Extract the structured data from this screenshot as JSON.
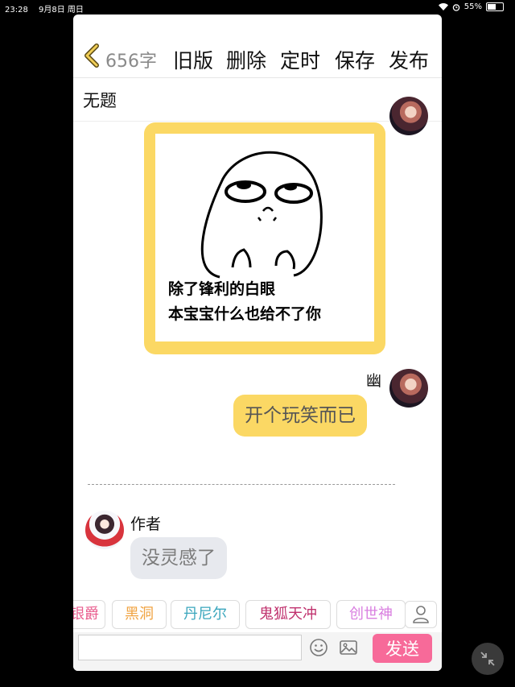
{
  "status_bar": {
    "time": "23:28",
    "date": "9月8日 周日",
    "battery": "55%",
    "battery_level": 0.55
  },
  "header": {
    "char_count": "656字",
    "actions": [
      "旧版",
      "删除",
      "定时",
      "保存",
      "发布"
    ]
  },
  "title": "无题",
  "chat": {
    "meme": {
      "line1": "除了锋利的白眼",
      "line2": "本宝宝什么也给不了你"
    },
    "message1": {
      "sender": "幽",
      "text": "开个玩笑而已"
    },
    "message2": {
      "sender": "作者",
      "text": "没灵感了"
    }
  },
  "tags": [
    {
      "label": "银爵",
      "color": "#e95d8e"
    },
    {
      "label": "黑洞",
      "color": "#f0a341"
    },
    {
      "label": "丹尼尔",
      "color": "#3aa6bd"
    },
    {
      "label": "鬼狐天冲",
      "color": "#c0326e"
    },
    {
      "label": "创世神",
      "color": "#d97fe0"
    }
  ],
  "input": {
    "value": "",
    "placeholder": ""
  },
  "send_label": "发送",
  "colors": {
    "accent_yellow": "#fbd864",
    "send_pink": "#f76a99"
  }
}
